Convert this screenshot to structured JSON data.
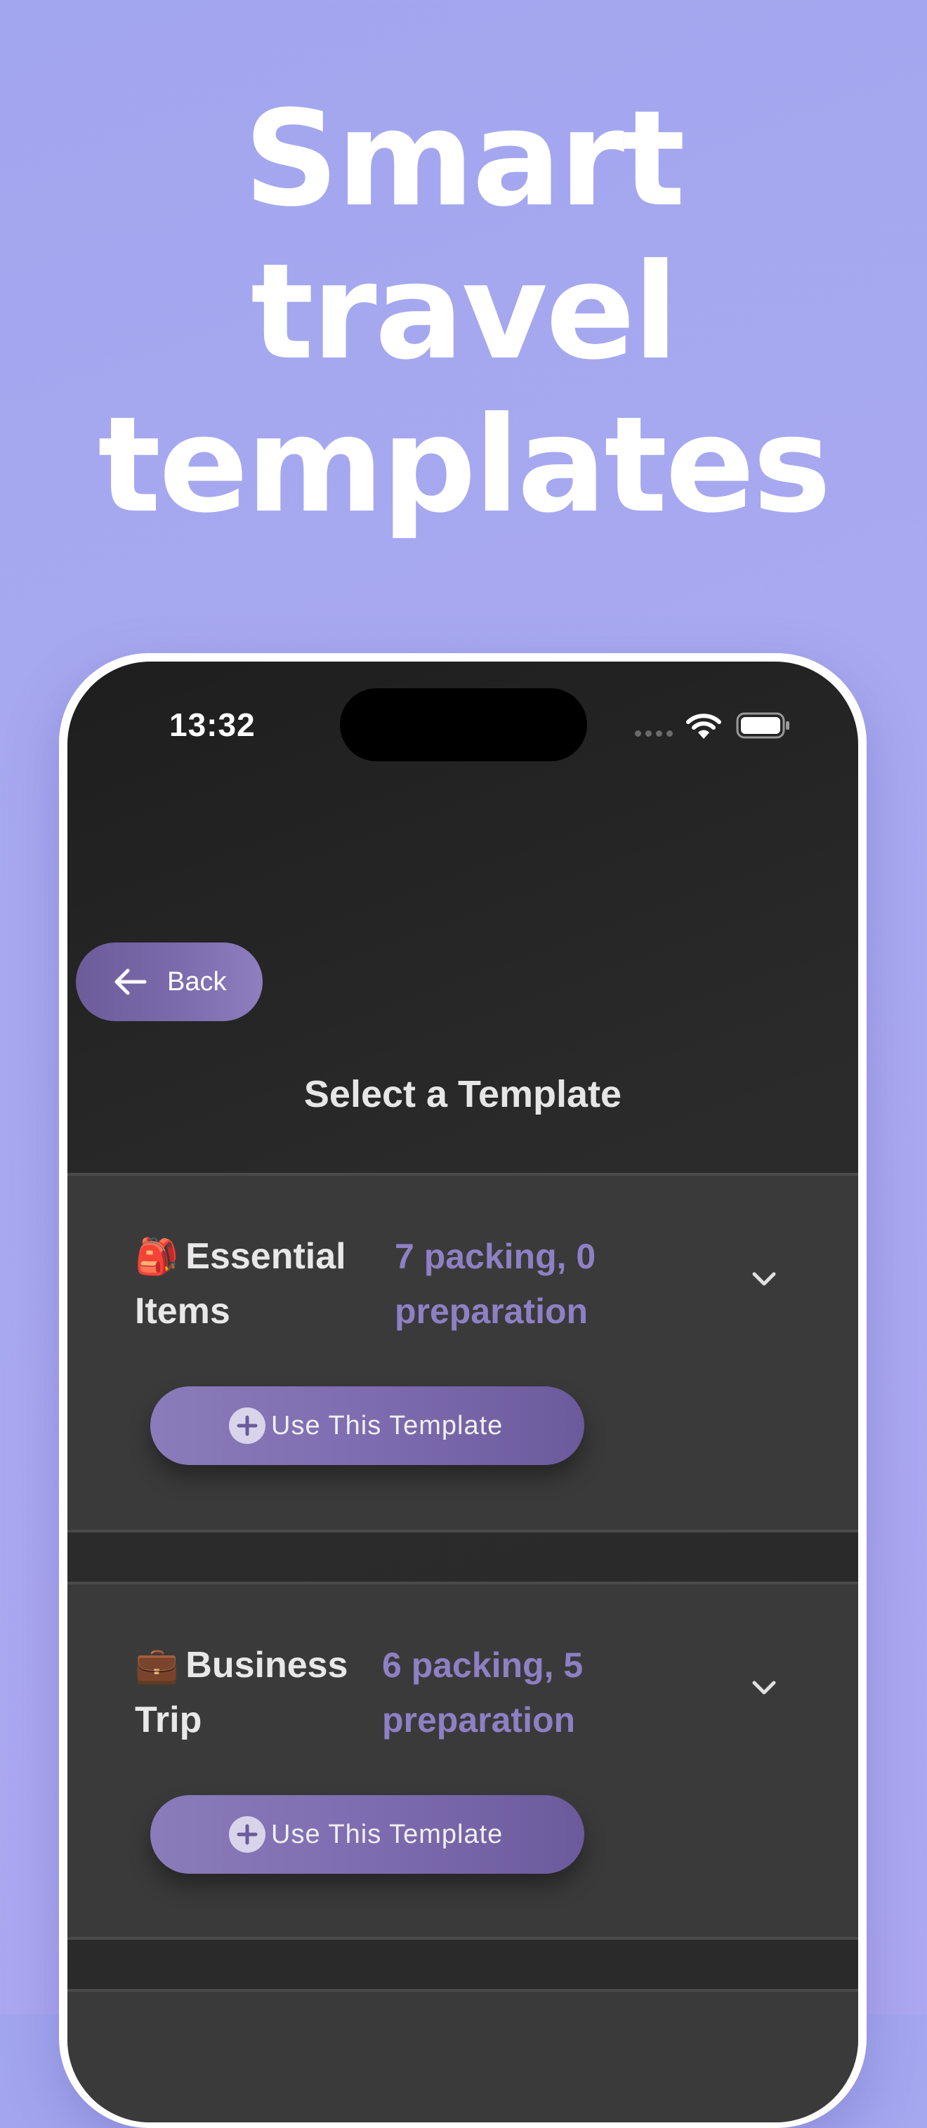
{
  "headline": {
    "line1": "Smart",
    "line2": "travel",
    "line3": "templates"
  },
  "status_bar": {
    "time": "13:32",
    "icons": [
      "signal-dots-icon",
      "wifi-icon",
      "battery-icon"
    ]
  },
  "nav": {
    "back_label": "Back",
    "back_icon": "arrow-left-icon"
  },
  "page": {
    "title": "Select a Template"
  },
  "templates": [
    {
      "emoji": "🎒",
      "name": "Essential Items",
      "summary": "7 packing, 0 preparation",
      "button_label": "Use This Template"
    },
    {
      "emoji": "💼",
      "name": "Business Trip",
      "summary": "6 packing, 5 preparation",
      "button_label": "Use This Template"
    }
  ],
  "colors": {
    "background": "#a6a8ef",
    "accent": "#8e80c4",
    "button": "#7e6cb0",
    "card": "#3a3a3a"
  }
}
